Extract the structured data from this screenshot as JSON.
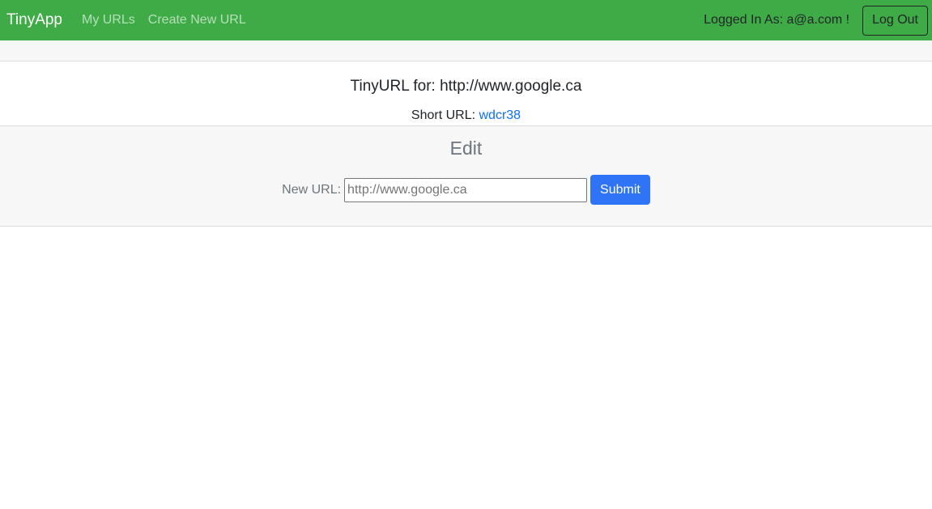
{
  "navbar": {
    "brand": "TinyApp",
    "links": [
      {
        "label": "My URLs"
      },
      {
        "label": "Create New URL"
      }
    ],
    "logged_in_text": "Logged In As: a@a.com !",
    "logout_label": "Log Out",
    "background_color": "#3eab47"
  },
  "url_card": {
    "title": "TinyURL for: http://www.google.ca",
    "short_url_label": "Short URL:",
    "short_url_value": "wdcr38"
  },
  "edit": {
    "title": "Edit",
    "new_url_label": "New URL:",
    "input_placeholder": "http://www.google.ca",
    "submit_label": "Submit",
    "submit_color": "#2f74f7"
  }
}
